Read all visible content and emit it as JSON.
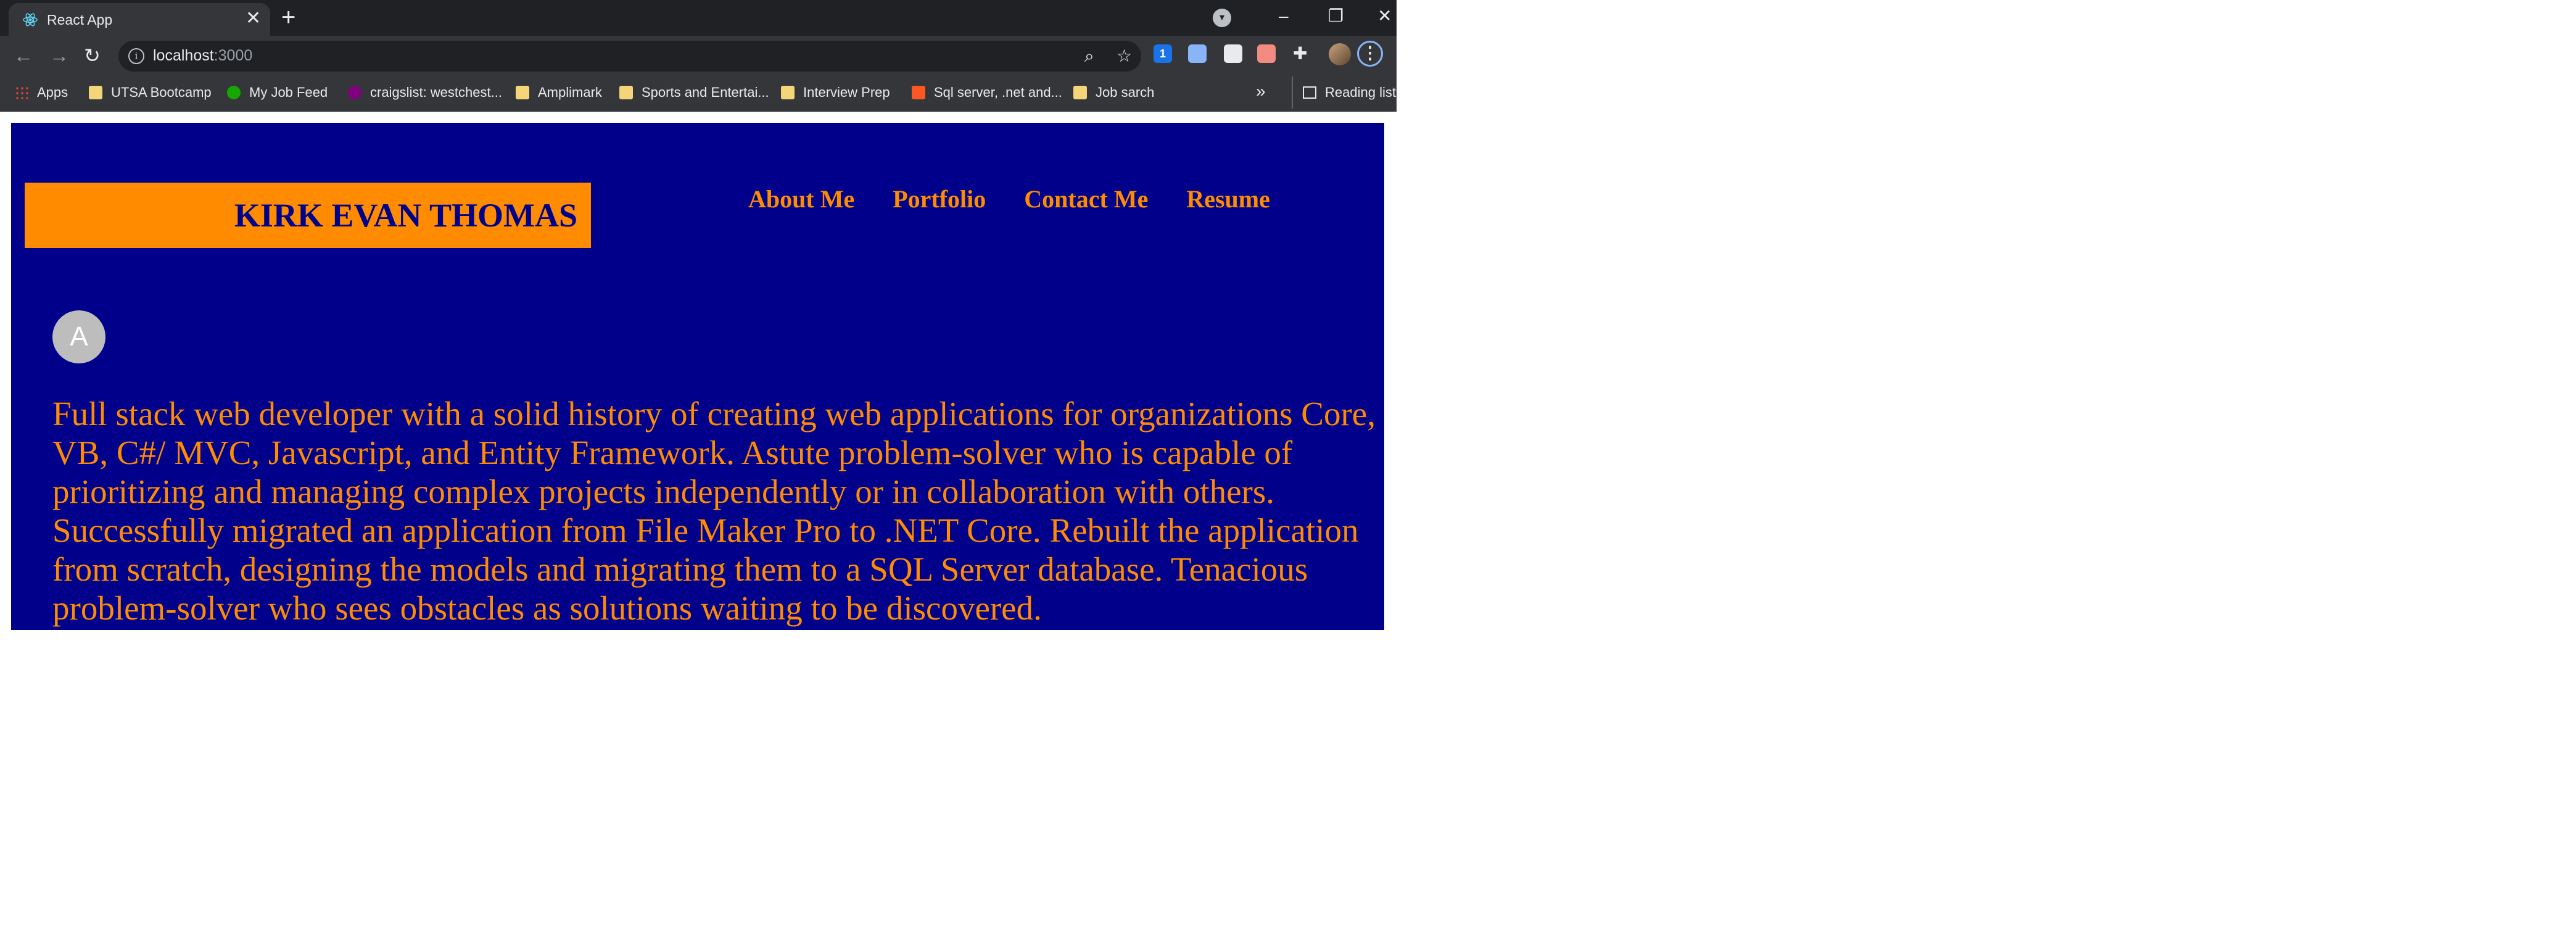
{
  "browser": {
    "tab": {
      "title": "React App",
      "close": "✕"
    },
    "new_tab": "+",
    "tab_search": "▾",
    "window": {
      "minimize": "–",
      "restore": "❐",
      "close": "✕"
    },
    "nav": {
      "back": "←",
      "forward": "→",
      "reload": "↻"
    },
    "address": {
      "host": "localhost",
      "port": ":3000",
      "info": "i"
    },
    "zoom_icon": "⌕",
    "star_icon": "☆",
    "extensions": [
      {
        "name": "1password-icon",
        "color": "#1a73e8",
        "label": "1"
      },
      {
        "name": "circle-extension-icon",
        "color": "#8ab4f8",
        "label": ""
      },
      {
        "name": "arrow-extension-icon",
        "color": "#e8eaed",
        "label": ""
      },
      {
        "name": "video-extension-icon",
        "color": "#f28b82",
        "label": ""
      }
    ],
    "puzzle_icon": "✚",
    "menu_icon": "⋮",
    "bookmarks": [
      {
        "label": "Apps",
        "icon": "apps-grid",
        "color": "#ea4335"
      },
      {
        "label": "UTSA Bootcamp",
        "icon": "folder",
        "color": "#f4d57a"
      },
      {
        "label": "My Job Feed",
        "icon": "upwork",
        "color": "#14a800"
      },
      {
        "label": "craigslist: westchest...",
        "icon": "craigslist",
        "color": "#800080"
      },
      {
        "label": "Amplimark",
        "icon": "folder",
        "color": "#f4d57a"
      },
      {
        "label": "Sports and Entertai...",
        "icon": "folder",
        "color": "#f4d57a"
      },
      {
        "label": "Interview Prep",
        "icon": "folder",
        "color": "#f4d57a"
      },
      {
        "label": "Sql server, .net and...",
        "icon": "blogger",
        "color": "#ff5722"
      },
      {
        "label": "Job sarch",
        "icon": "folder",
        "color": "#f4d57a"
      }
    ],
    "bookmarks_more": "»",
    "reading_list": "Reading list"
  },
  "site": {
    "name": "KIRK EVAN THOMAS",
    "nav": [
      "About Me",
      "Portfolio",
      "Contact Me",
      "Resume"
    ],
    "avatar_letter": "A",
    "bio": "Full stack web developer with a solid history of creating web applications for organizations Core, VB, C#/ MVC, Javascript, and Entity Framework. Astute problem-solver who is capable of prioritizing and managing complex projects independently or in collaboration with others. Successfully migrated an application from File Maker Pro to .NET Core. Rebuilt the application from scratch, designing the models and migrating them to a SQL Server database. Tenacious problem-solver who sees obstacles as solutions waiting to be discovered.",
    "colors": {
      "background": "#00008b",
      "accent": "#ff8c00"
    }
  }
}
